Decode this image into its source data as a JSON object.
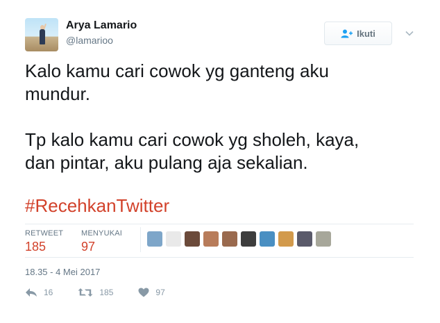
{
  "user": {
    "name": "Arya Lamario",
    "handle": "@lamarioo"
  },
  "follow_button": {
    "label": "Ikuti"
  },
  "tweet": {
    "text": "Kalo kamu cari cowok yg ganteng aku\nmundur.\n\nTp kalo kamu cari cowok yg sholeh, kaya,\ndan pintar, aku pulang aja sekalian.",
    "hashtag": "#RecehkanTwitter",
    "timestamp": "18.35 - 4 Mei 2017"
  },
  "stats": {
    "retweet_label": "RETWEET",
    "retweet_count": "185",
    "like_label": "MENYUKAI",
    "like_count": "97"
  },
  "actions": {
    "reply_count": "16",
    "retweet_count": "185",
    "like_count": "97"
  },
  "liker_avatars": [
    {
      "color": "#7ea6c9"
    },
    {
      "color": "#e9e9e9"
    },
    {
      "color": "#6b4a3a"
    },
    {
      "color": "#b87c5a"
    },
    {
      "color": "#9a6a4e"
    },
    {
      "color": "#3d3d3d"
    },
    {
      "color": "#4a8fc2"
    },
    {
      "color": "#d29a4c"
    },
    {
      "color": "#5a5a6a"
    },
    {
      "color": "#a7a79a"
    }
  ],
  "colors": {
    "hashtag": "#d2422b",
    "stat_value": "#d2422b",
    "muted": "#657786"
  },
  "icons": {
    "follow": "person-plus-icon",
    "caret": "chevron-down-icon",
    "reply": "reply-icon",
    "retweet": "retweet-icon",
    "like": "heart-icon"
  }
}
